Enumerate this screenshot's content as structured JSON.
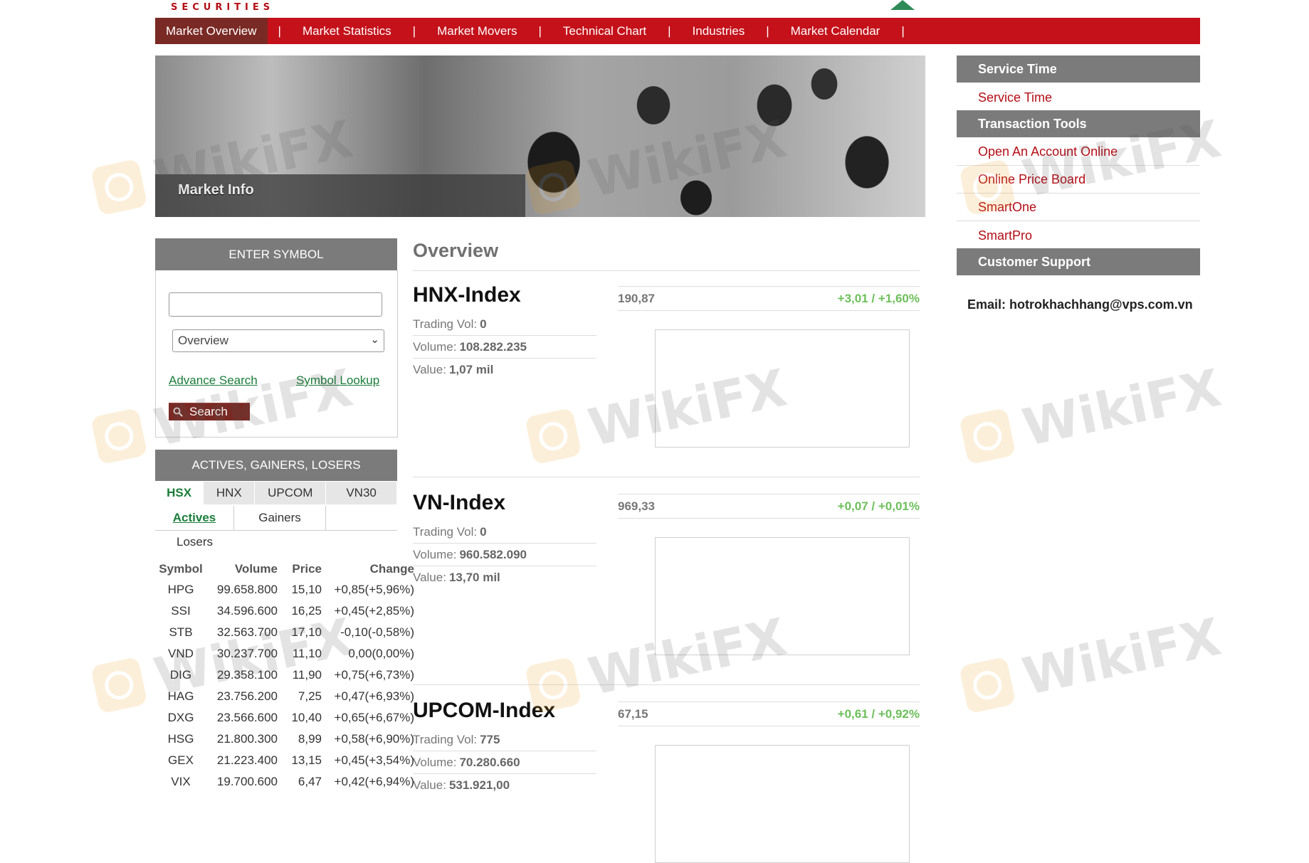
{
  "brand": {
    "text": "SECURITIES"
  },
  "nav": {
    "items": [
      "Market Overview",
      "Market Statistics",
      "Market Movers",
      "Technical Chart",
      "Industries",
      "Market Calendar"
    ],
    "separator": "|"
  },
  "banner": {
    "label": "Market Info"
  },
  "symbol_panel": {
    "header": "ENTER SYMBOL",
    "input_value": "",
    "select_value": "Overview",
    "advance_search": "Advance Search",
    "symbol_lookup": "Symbol Lookup",
    "search_button": "Search"
  },
  "movers": {
    "header": "ACTIVES, GAINERS, LOSERS",
    "exchange_tabs": [
      "HSX",
      "HNX",
      "UPCOM",
      "VN30"
    ],
    "type_tabs": [
      "Actives",
      "Gainers",
      "Losers"
    ],
    "columns": [
      "Symbol",
      "Volume",
      "Price",
      "Change"
    ],
    "rows": [
      {
        "symbol": "HPG",
        "volume": "99.658.800",
        "price": "15,10",
        "change": "+0,85(+5,96%)",
        "dir": "up"
      },
      {
        "symbol": "SSI",
        "volume": "34.596.600",
        "price": "16,25",
        "change": "+0,45(+2,85%)",
        "dir": "up"
      },
      {
        "symbol": "STB",
        "volume": "32.563.700",
        "price": "17,10",
        "change": "-0,10(-0,58%)",
        "dir": "down"
      },
      {
        "symbol": "VND",
        "volume": "30.237.700",
        "price": "11,10",
        "change": "0,00(0,00%)",
        "dir": "flat"
      },
      {
        "symbol": "DIG",
        "volume": "29.358.100",
        "price": "11,90",
        "change": "+0,75(+6,73%)",
        "dir": "up"
      },
      {
        "symbol": "HAG",
        "volume": "23.756.200",
        "price": "7,25",
        "change": "+0,47(+6,93%)",
        "dir": "up"
      },
      {
        "symbol": "DXG",
        "volume": "23.566.600",
        "price": "10,40",
        "change": "+0,65(+6,67%)",
        "dir": "up"
      },
      {
        "symbol": "HSG",
        "volume": "21.800.300",
        "price": "8,99",
        "change": "+0,58(+6,90%)",
        "dir": "up"
      },
      {
        "symbol": "GEX",
        "volume": "21.223.400",
        "price": "13,15",
        "change": "+0,45(+3,54%)",
        "dir": "up"
      },
      {
        "symbol": "VIX",
        "volume": "19.700.600",
        "price": "6,47",
        "change": "+0,42(+6,94%)",
        "dir": "up"
      }
    ]
  },
  "overview": {
    "title": "Overview",
    "indices": [
      {
        "name": "HNX-Index",
        "value": "190,87",
        "change": "+3,01 / +1,60%",
        "trading_vol_label": "Trading Vol:",
        "trading_vol": "0",
        "volume_label": "Volume:",
        "volume": "108.282.235",
        "value_label": "Value:",
        "value_amount": "1,07 mil"
      },
      {
        "name": "VN-Index",
        "value": "969,33",
        "change": "+0,07 / +0,01%",
        "trading_vol_label": "Trading Vol:",
        "trading_vol": "0",
        "volume_label": "Volume:",
        "volume": "960.582.090",
        "value_label": "Value:",
        "value_amount": "13,70 mil"
      },
      {
        "name": "UPCOM-Index",
        "value": "67,15",
        "change": "+0,61 / +0,92%",
        "trading_vol_label": "Trading Vol:",
        "trading_vol": "775",
        "volume_label": "Volume:",
        "volume": "70.280.660",
        "value_label": "Value:",
        "value_amount": "531.921,00"
      }
    ]
  },
  "sidebar": {
    "service_time_header": "Service Time",
    "service_time_link": "Service Time",
    "tools_header": "Transaction Tools",
    "tools": [
      "Open An Account Online",
      "Online Price Board",
      "SmartOne",
      "SmartPro"
    ],
    "support_header": "Customer Support",
    "email_label": "Email:",
    "email": "hotrokhachhang@vps.com.vn"
  },
  "watermark": {
    "text": "WikiFX"
  },
  "colors": {
    "nav_red": "#c4111a",
    "active_tab": "#7a2a24",
    "link_green": "#1a7d3a",
    "gain_green": "#2a9d2a",
    "loss_red": "#b40d16"
  }
}
